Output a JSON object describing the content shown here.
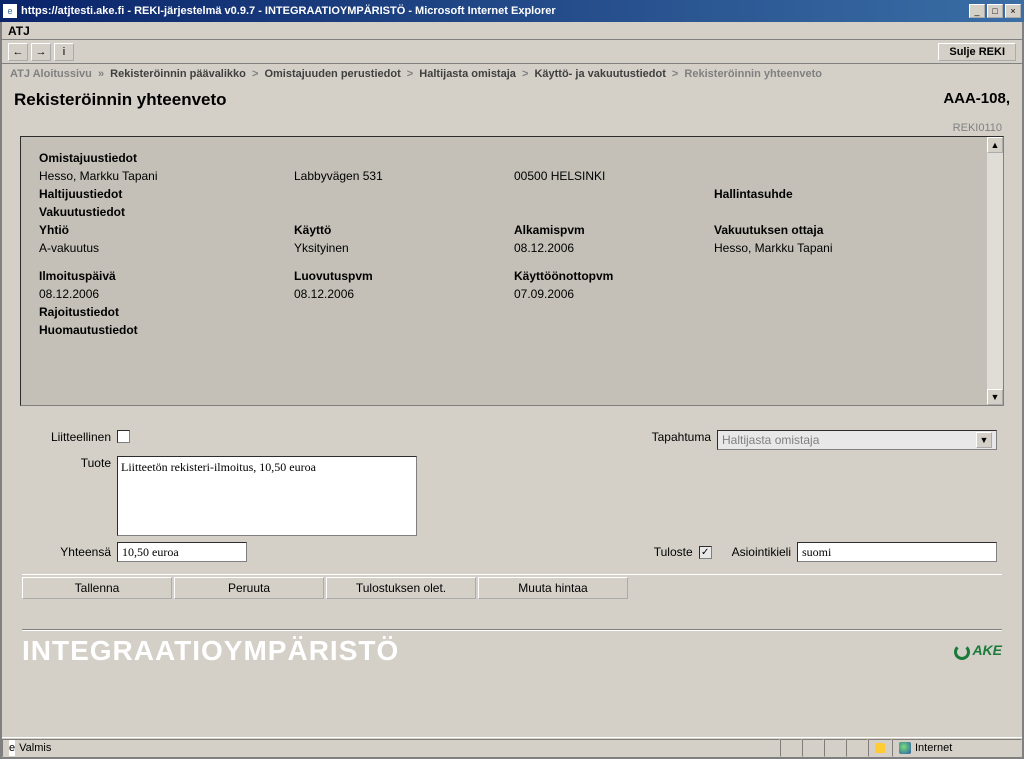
{
  "window": {
    "title": "https://atjtesti.ake.fi - REKI-järjestelmä v0.9.7 - INTEGRAATIOYMPÄRISTÖ - Microsoft Internet Explorer"
  },
  "atj_label": "ATJ",
  "close_reki": "Sulje REKI",
  "breadcrumb": {
    "b1": "ATJ Aloitussivu",
    "b2": "Rekisteröinnin päävalikko",
    "b3": "Omistajuuden perustiedot",
    "b4": "Haltijasta omistaja",
    "b5": "Käyttö- ja vakuutustiedot",
    "b6": "Rekisteröinnin yhteenveto"
  },
  "page": {
    "title": "Rekisteröinnin yhteenveto",
    "plate": "AAA-108,",
    "screen_id": "REKI0110"
  },
  "summary": {
    "omistajuus_hdr": "Omistajuustiedot",
    "owner_name": "Hesso, Markku Tapani",
    "owner_addr": "Labbyvägen 531",
    "owner_city": "00500 HELSINKI",
    "haltijuus_hdr": "Haltijuustiedot",
    "hallintasuhde_hdr": "Hallintasuhde",
    "vakuutus_hdr": "Vakuutustiedot",
    "yhtio_lbl": "Yhtiö",
    "yhtio_val": "A-vakuutus",
    "kaytto_lbl": "Käyttö",
    "kaytto_val": "Yksityinen",
    "alkamis_lbl": "Alkamispvm",
    "alkamis_val": "08.12.2006",
    "ottaja_lbl": "Vakuutuksen ottaja",
    "ottaja_val": "Hesso, Markku Tapani",
    "ilmoitus_lbl": "Ilmoituspäivä",
    "ilmoitus_val": "08.12.2006",
    "luovutus_lbl": "Luovutuspvm",
    "luovutus_val": "08.12.2006",
    "kotto_lbl": "Käyttöönottopvm",
    "kotto_val": "07.09.2006",
    "rajoitus_hdr": "Rajoitustiedot",
    "huomautus_hdr": "Huomautustiedot"
  },
  "form": {
    "liitteellinen_lbl": "Liitteellinen",
    "tapahtuma_lbl": "Tapahtuma",
    "tapahtuma_val": "Haltijasta omistaja",
    "tuote_lbl": "Tuote",
    "tuote_val": "Liitteetön rekisteri-ilmoitus, 10,50 euroa",
    "yhteensa_lbl": "Yhteensä",
    "yhteensa_val": "10,50 euroa",
    "tuloste_lbl": "Tuloste",
    "tuloste_checked": "✓",
    "asiointi_lbl": "Asiointikieli",
    "asiointi_val": "suomi"
  },
  "buttons": {
    "tallenna": "Tallenna",
    "peruuta": "Peruuta",
    "tulostuksen": "Tulostuksen olet.",
    "muuta": "Muuta hintaa"
  },
  "watermark": "INTEGRAATIOYMPÄRISTÖ",
  "logo": "AKE",
  "status": {
    "ready": "Valmis",
    "zone": "Internet"
  }
}
